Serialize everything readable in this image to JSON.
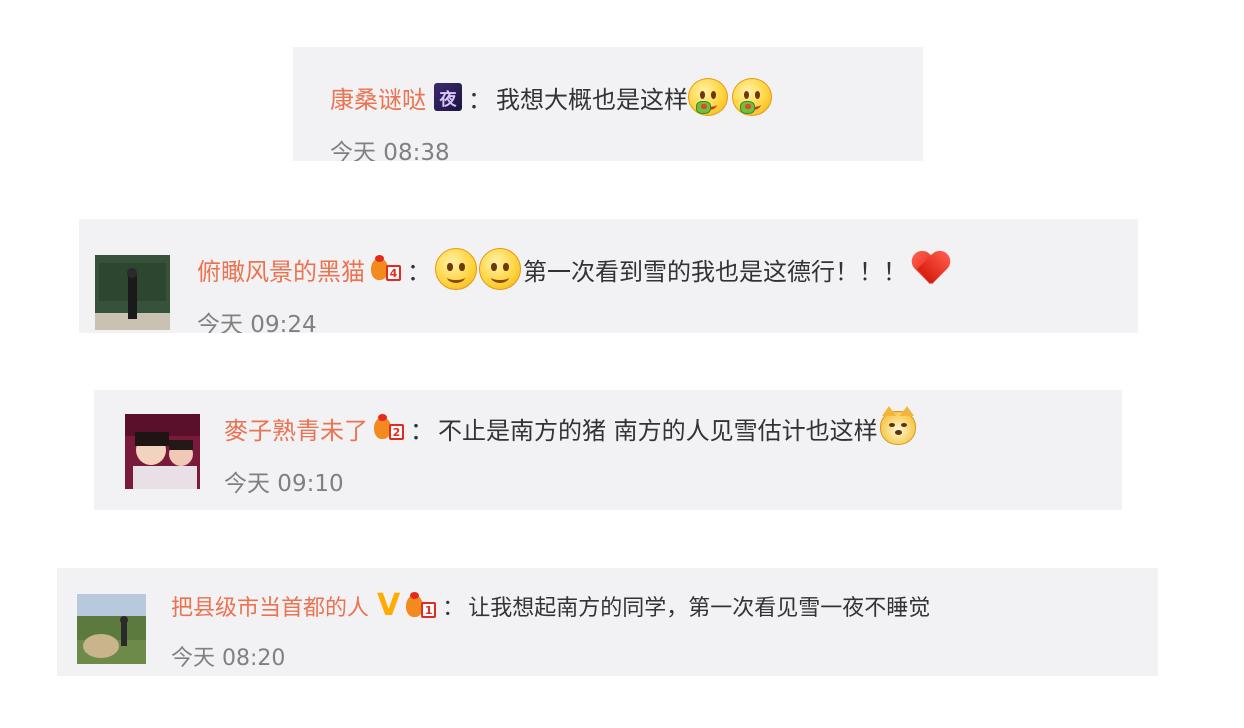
{
  "comments": [
    {
      "username": "康桑谜哒",
      "badge_text": "夜",
      "colon": "：",
      "text": "我想大概也是这样",
      "emojis": [
        "yum-face-icon",
        "yum-face-icon"
      ],
      "time": "今天 08:38"
    },
    {
      "username": "俯瞰风景的黑猫",
      "vip_level": "4",
      "colon": "：",
      "emojis": [
        "smile-face-icon",
        "smile-face-icon"
      ],
      "text": "第一次看到雪的我也是这德行！！！",
      "trailing_emoji": "heart-icon",
      "time": "今天 09:24"
    },
    {
      "username": "麥子熟青未了",
      "vip_level": "2",
      "colon": "：",
      "text": "不止是南方的猪 南方的人见雪估计也这样",
      "trailing_emoji": "doge-icon",
      "time": "今天 09:10"
    },
    {
      "username": "把县级市当首都的人",
      "verified_badge": "V",
      "vip_level": "1",
      "colon": "：",
      "text": "让我想起南方的同学，第一次看见雪一夜不睡觉",
      "time": "今天 08:20"
    }
  ],
  "colors": {
    "card_bg": "#f2f2f5",
    "username": "#eb7350",
    "text": "#333333",
    "time": "#808080"
  }
}
